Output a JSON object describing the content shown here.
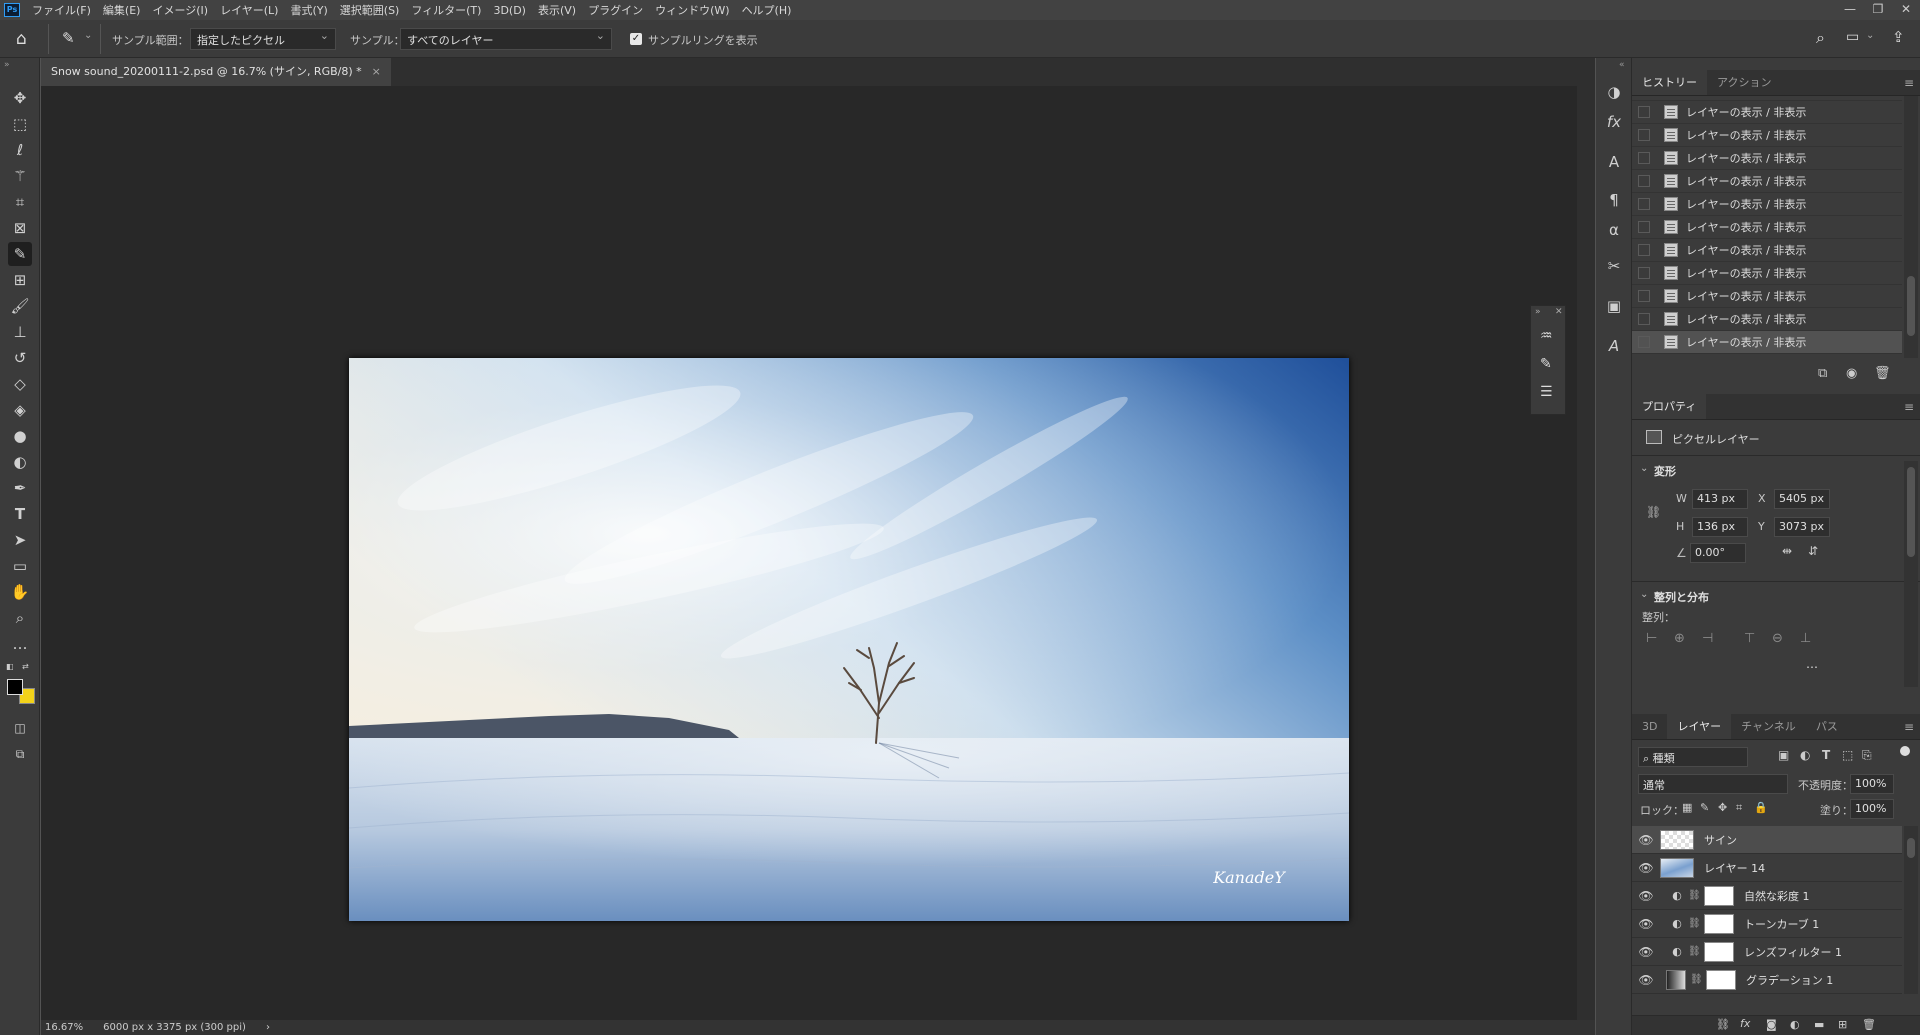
{
  "app": {
    "logo": "Ps"
  },
  "menu": [
    "ファイル(F)",
    "編集(E)",
    "イメージ(I)",
    "レイヤー(L)",
    "書式(Y)",
    "選択範囲(S)",
    "フィルター(T)",
    "3D(D)",
    "表示(V)",
    "プラグイン",
    "ウィンドウ(W)",
    "ヘルプ(H)"
  ],
  "window_controls": {
    "minimize": "—",
    "restore": "❐",
    "close": "✕"
  },
  "options": {
    "sample_size_label": "サンプル範囲：",
    "sample_size_value": "指定したピクセル",
    "sample_label": "サンプル：",
    "sample_value": "すべてのレイヤー",
    "show_ring_label": "サンプルリングを表示",
    "show_ring_checked": true
  },
  "document": {
    "tab_title": "Snow sound_20200111-2.psd @ 16.7% (サイン, RGB/8) *",
    "close": "×",
    "signature": "KanadeY"
  },
  "status": {
    "zoom": "16.67%",
    "doc_info": "6000 px x 3375 px (300 ppi)",
    "arrow": "›"
  },
  "history": {
    "tabs": [
      "ヒストリー",
      "アクション"
    ],
    "items": [
      "レイヤーの表示 / 非表示",
      "レイヤーの表示 / 非表示",
      "レイヤーの表示 / 非表示",
      "レイヤーの表示 / 非表示",
      "レイヤーの表示 / 非表示",
      "レイヤーの表示 / 非表示",
      "レイヤーの表示 / 非表示",
      "レイヤーの表示 / 非表示",
      "レイヤーの表示 / 非表示",
      "レイヤーの表示 / 非表示",
      "レイヤーの表示 / 非表示"
    ]
  },
  "properties": {
    "tab": "プロパティ",
    "layer_type": "ピクセルレイヤー",
    "transform_title": "変形",
    "w_label": "W",
    "w": "413 px",
    "h_label": "H",
    "h": "136 px",
    "x_label": "X",
    "x": "5405 px",
    "y_label": "Y",
    "y": "3073 px",
    "angle": "0.00°",
    "align_title": "整列と分布",
    "align_label": "整列：",
    "more": "…"
  },
  "layers": {
    "tabs": [
      "3D",
      "レイヤー",
      "チャンネル",
      "パス"
    ],
    "filter_value": "種類",
    "blend_mode": "通常",
    "opacity_label": "不透明度：",
    "opacity": "100%",
    "lock_label": "ロック：",
    "fill_label": "塗り：",
    "fill": "100%",
    "items": [
      {
        "name": "サイン",
        "kind": "pixel",
        "selected": true
      },
      {
        "name": "レイヤー 14",
        "kind": "image",
        "selected": false
      },
      {
        "name": "自然な彩度 1",
        "kind": "adjust",
        "selected": false
      },
      {
        "name": "トーンカーブ 1",
        "kind": "adjust",
        "selected": false
      },
      {
        "name": "レンズフィルター 1",
        "kind": "adjust",
        "selected": false
      },
      {
        "name": "グラデーション 1",
        "kind": "gradient",
        "selected": false
      }
    ]
  },
  "colors": {
    "foreground": "#000000",
    "background": "#f2d21a",
    "accent": "#2f9cf5"
  }
}
